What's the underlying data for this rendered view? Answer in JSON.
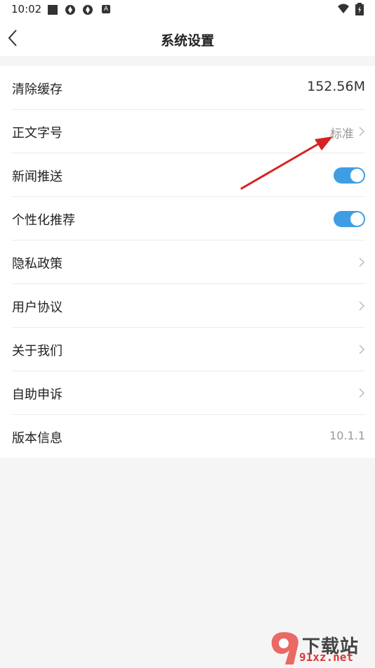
{
  "status_bar": {
    "time": "10:02",
    "icons": [
      "square-icon",
      "app-icon-1",
      "app-icon-2",
      "a-icon",
      "wifi-icon",
      "battery-icon"
    ],
    "a_label": "A"
  },
  "nav": {
    "title": "系统设置",
    "back_icon": "chevron-left-icon"
  },
  "settings": [
    {
      "label": "清除缓存",
      "value": "152.56M",
      "kind": "value-big"
    },
    {
      "label": "正文字号",
      "value": "标准",
      "kind": "value-chevron"
    },
    {
      "label": "新闻推送",
      "toggle": true,
      "kind": "toggle"
    },
    {
      "label": "个性化推荐",
      "toggle": true,
      "kind": "toggle"
    },
    {
      "label": "隐私政策",
      "kind": "chevron"
    },
    {
      "label": "用户协议",
      "kind": "chevron"
    },
    {
      "label": "关于我们",
      "kind": "chevron"
    },
    {
      "label": "自助申诉",
      "kind": "chevron"
    },
    {
      "label": "版本信息",
      "value": "10.1.1",
      "kind": "value-plain"
    }
  ],
  "colors": {
    "accent": "#3f9ee3",
    "annotation": "#d62222",
    "background": "#f5f5f5"
  },
  "watermark": {
    "title": "下载站",
    "url": "91xz.net"
  }
}
